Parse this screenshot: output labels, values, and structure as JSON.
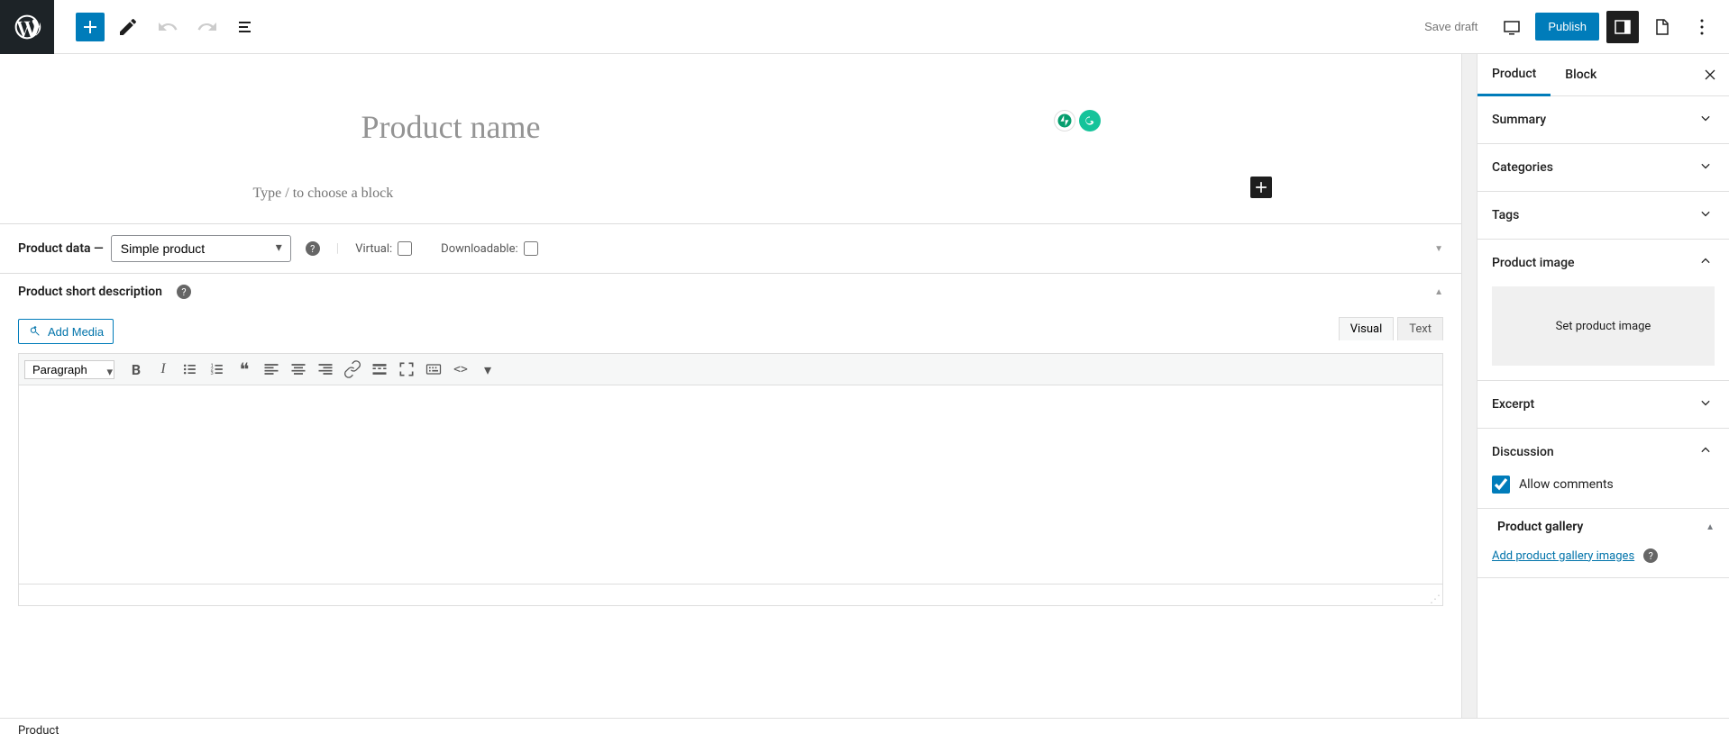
{
  "topbar": {
    "save_draft": "Save draft",
    "publish": "Publish"
  },
  "editor": {
    "title_placeholder": "Product name",
    "block_placeholder": "Type / to choose a block"
  },
  "product_data": {
    "label": "Product data",
    "select_value": "Simple product",
    "virtual_label": "Virtual:",
    "downloadable_label": "Downloadable:"
  },
  "short_desc": {
    "title": "Product short description",
    "add_media": "Add Media",
    "tab_visual": "Visual",
    "tab_text": "Text",
    "para_select": "Paragraph"
  },
  "sidebar": {
    "tab_product": "Product",
    "tab_block": "Block",
    "summary": "Summary",
    "categories": "Categories",
    "tags": "Tags",
    "product_image": "Product image",
    "set_image": "Set product image",
    "excerpt": "Excerpt",
    "discussion": "Discussion",
    "allow_comments": "Allow comments",
    "product_gallery": "Product gallery",
    "add_gallery": "Add product gallery images"
  },
  "status": {
    "breadcrumb": "Product"
  }
}
